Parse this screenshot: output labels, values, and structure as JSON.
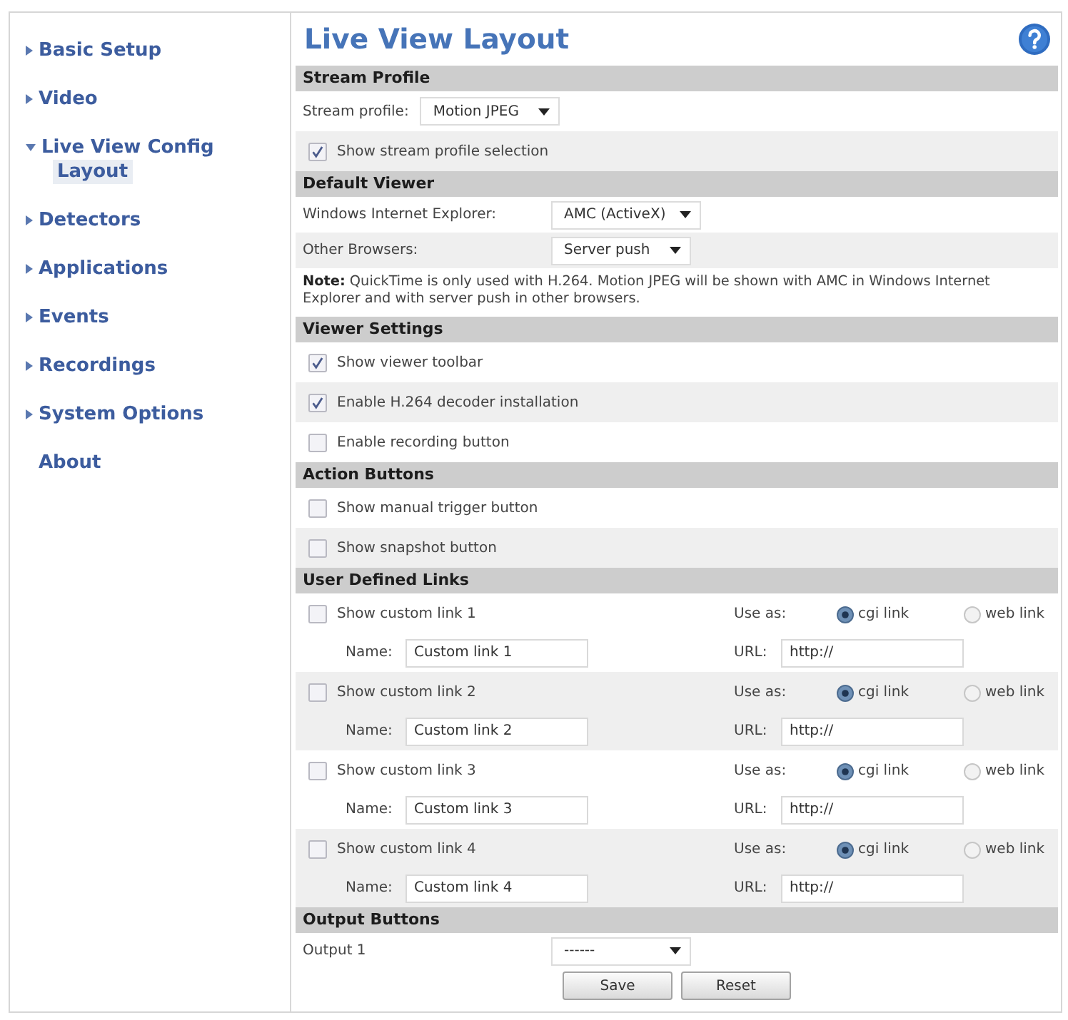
{
  "sidebar": {
    "items": [
      {
        "kind": "menu",
        "label": "Basic Setup",
        "expanded": false
      },
      {
        "kind": "menu",
        "label": "Video",
        "expanded": false
      },
      {
        "kind": "menu",
        "label": "Live View Config",
        "expanded": true,
        "children": [
          {
            "label": "Layout",
            "selected": true
          }
        ]
      },
      {
        "kind": "menu",
        "label": "Detectors",
        "expanded": false
      },
      {
        "kind": "menu",
        "label": "Applications",
        "expanded": false
      },
      {
        "kind": "menu",
        "label": "Events",
        "expanded": false
      },
      {
        "kind": "menu",
        "label": "Recordings",
        "expanded": false
      },
      {
        "kind": "menu",
        "label": "System Options",
        "expanded": false
      },
      {
        "kind": "link",
        "label": "About"
      }
    ]
  },
  "page": {
    "title": "Live View Layout"
  },
  "sections": [
    {
      "title": "Stream Profile",
      "rows": [
        {
          "kind": "inline_select",
          "label": "Stream profile:",
          "value": "Motion JPEG"
        },
        {
          "kind": "checkbox",
          "label": "Show stream profile selection",
          "checked": true
        }
      ]
    },
    {
      "title": "Default Viewer",
      "rows": [
        {
          "kind": "select",
          "label": "Windows Internet Explorer:",
          "value": "AMC (ActiveX)"
        },
        {
          "kind": "select",
          "label": "Other Browsers:",
          "value": "Server push"
        },
        {
          "kind": "note",
          "text": "**Note:** QuickTime is only used with H.264. Motion JPEG will be shown with AMC in Windows Internet Explorer and with server push in other browsers."
        }
      ]
    },
    {
      "title": "Viewer Settings",
      "rows": [
        {
          "kind": "checkbox",
          "label": "Show viewer toolbar",
          "checked": true
        },
        {
          "kind": "checkbox",
          "label": "Enable H.264 decoder installation",
          "checked": true
        },
        {
          "kind": "checkbox",
          "label": "Enable recording button",
          "checked": false
        }
      ]
    },
    {
      "title": "Action Buttons",
      "rows": [
        {
          "kind": "checkbox",
          "label": "Show manual trigger button",
          "checked": false
        },
        {
          "kind": "checkbox",
          "label": "Show snapshot button",
          "checked": false
        }
      ]
    },
    {
      "title": "User Defined Links",
      "rows": [
        {
          "kind": "link",
          "label": "Show custom link 1",
          "checked": false,
          "use_as": "Use as:",
          "options": [
            {
              "label": "cgi link",
              "selected": true
            },
            {
              "label": "web link",
              "selected": false
            }
          ],
          "name_label": "Name:",
          "name": "Custom link 1",
          "url_label": "URL:",
          "url": "http://"
        },
        {
          "kind": "link",
          "label": "Show custom link 2",
          "checked": false,
          "use_as": "Use as:",
          "options": [
            {
              "label": "cgi link",
              "selected": true
            },
            {
              "label": "web link",
              "selected": false
            }
          ],
          "name_label": "Name:",
          "name": "Custom link 2",
          "url_label": "URL:",
          "url": "http://"
        },
        {
          "kind": "link",
          "label": "Show custom link 3",
          "checked": false,
          "use_as": "Use as:",
          "options": [
            {
              "label": "cgi link",
              "selected": true
            },
            {
              "label": "web link",
              "selected": false
            }
          ],
          "name_label": "Name:",
          "name": "Custom link 3",
          "url_label": "URL:",
          "url": "http://"
        },
        {
          "kind": "link",
          "label": "Show custom link 4",
          "checked": false,
          "use_as": "Use as:",
          "options": [
            {
              "label": "cgi link",
              "selected": true
            },
            {
              "label": "web link",
              "selected": false
            }
          ],
          "name_label": "Name:",
          "name": "Custom link 4",
          "url_label": "URL:",
          "url": "http://"
        }
      ]
    },
    {
      "title": "Output Buttons",
      "rows": [
        {
          "kind": "select",
          "label": "Output 1",
          "value": "------"
        }
      ]
    }
  ],
  "buttons": [
    {
      "label": "Save"
    },
    {
      "label": "Reset"
    }
  ]
}
